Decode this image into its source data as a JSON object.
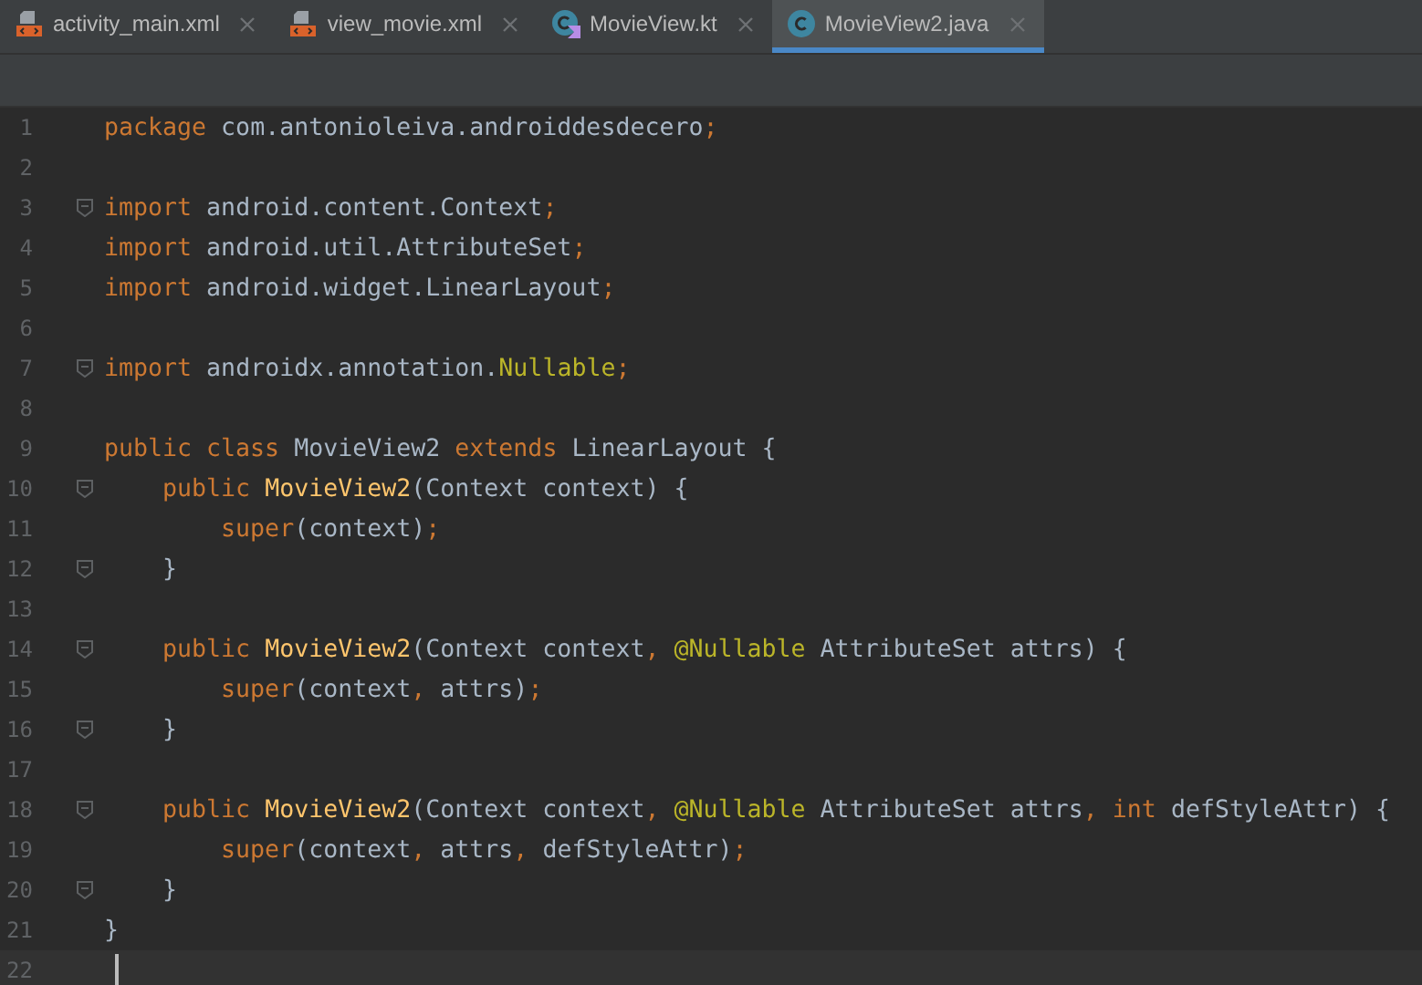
{
  "tabs": [
    {
      "label": "activity_main.xml",
      "kind": "xml",
      "selected": false
    },
    {
      "label": "view_movie.xml",
      "kind": "xml",
      "selected": false
    },
    {
      "label": "MovieView.kt",
      "kind": "kotlin",
      "selected": false
    },
    {
      "label": "MovieView2.java",
      "kind": "java",
      "selected": true
    }
  ],
  "editor": {
    "lines": [
      {
        "number": "1",
        "fold": false,
        "current": false,
        "tokens": [
          {
            "kind": "kw",
            "text": "package"
          },
          {
            "kind": "plain",
            "text": " com.antonioleiva.androiddesdecero"
          },
          {
            "kind": "punct",
            "text": ";"
          }
        ]
      },
      {
        "number": "2",
        "fold": false,
        "current": false
      },
      {
        "number": "3",
        "fold": true,
        "current": false,
        "tokens": [
          {
            "kind": "kw",
            "text": "import"
          },
          {
            "kind": "plain",
            "text": " android.content.Context"
          },
          {
            "kind": "punct",
            "text": ";"
          }
        ]
      },
      {
        "number": "4",
        "fold": false,
        "current": false,
        "tokens": [
          {
            "kind": "kw",
            "text": "import"
          },
          {
            "kind": "plain",
            "text": " android.util.AttributeSet"
          },
          {
            "kind": "punct",
            "text": ";"
          }
        ]
      },
      {
        "number": "5",
        "fold": false,
        "current": false,
        "tokens": [
          {
            "kind": "kw",
            "text": "import"
          },
          {
            "kind": "plain",
            "text": " android.widget.LinearLayout"
          },
          {
            "kind": "punct",
            "text": ";"
          }
        ]
      },
      {
        "number": "6",
        "fold": false,
        "current": false
      },
      {
        "number": "7",
        "fold": true,
        "current": false,
        "tokens": [
          {
            "kind": "kw",
            "text": "import"
          },
          {
            "kind": "plain",
            "text": " androidx.annotation."
          },
          {
            "kind": "annotation",
            "text": "Nullable"
          },
          {
            "kind": "punct",
            "text": ";"
          }
        ]
      },
      {
        "number": "8",
        "fold": false,
        "current": false
      },
      {
        "number": "9",
        "fold": false,
        "current": false,
        "tokens": [
          {
            "kind": "kw",
            "text": "public class"
          },
          {
            "kind": "plain",
            "text": " MovieView2 "
          },
          {
            "kind": "kw",
            "text": "extends"
          },
          {
            "kind": "plain",
            "text": " LinearLayout {"
          }
        ]
      },
      {
        "number": "10",
        "fold": true,
        "current": false,
        "tokens": [
          {
            "kind": "kw",
            "text": "    public "
          },
          {
            "kind": "method",
            "text": "MovieView2"
          },
          {
            "kind": "plain",
            "text": "(Context context) {"
          }
        ]
      },
      {
        "number": "11",
        "fold": false,
        "current": false,
        "tokens": [
          {
            "kind": "kw",
            "text": "        super"
          },
          {
            "kind": "plain",
            "text": "(context)"
          },
          {
            "kind": "punct",
            "text": ";"
          }
        ]
      },
      {
        "number": "12",
        "fold": true,
        "current": false,
        "tokens": [
          {
            "kind": "plain",
            "text": "    }"
          }
        ]
      },
      {
        "number": "13",
        "fold": false,
        "current": false
      },
      {
        "number": "14",
        "fold": true,
        "current": false,
        "tokens": [
          {
            "kind": "kw",
            "text": "    public "
          },
          {
            "kind": "method",
            "text": "MovieView2"
          },
          {
            "kind": "plain",
            "text": "(Context context"
          },
          {
            "kind": "punct",
            "text": ", "
          },
          {
            "kind": "annotation",
            "text": "@Nullable"
          },
          {
            "kind": "plain",
            "text": " AttributeSet attrs) {"
          }
        ]
      },
      {
        "number": "15",
        "fold": false,
        "current": false,
        "tokens": [
          {
            "kind": "kw",
            "text": "        super"
          },
          {
            "kind": "plain",
            "text": "(context"
          },
          {
            "kind": "punct",
            "text": ", "
          },
          {
            "kind": "plain",
            "text": "attrs)"
          },
          {
            "kind": "punct",
            "text": ";"
          }
        ]
      },
      {
        "number": "16",
        "fold": true,
        "current": false,
        "tokens": [
          {
            "kind": "plain",
            "text": "    }"
          }
        ]
      },
      {
        "number": "17",
        "fold": false,
        "current": false
      },
      {
        "number": "18",
        "fold": true,
        "current": false,
        "tokens": [
          {
            "kind": "kw",
            "text": "    public "
          },
          {
            "kind": "method",
            "text": "MovieView2"
          },
          {
            "kind": "plain",
            "text": "(Context context"
          },
          {
            "kind": "punct",
            "text": ", "
          },
          {
            "kind": "annotation",
            "text": "@Nullable"
          },
          {
            "kind": "plain",
            "text": " AttributeSet attrs"
          },
          {
            "kind": "punct",
            "text": ", "
          },
          {
            "kind": "kw",
            "text": "int"
          },
          {
            "kind": "plain",
            "text": " defStyleAttr) {"
          }
        ]
      },
      {
        "number": "19",
        "fold": false,
        "current": false,
        "tokens": [
          {
            "kind": "kw",
            "text": "        super"
          },
          {
            "kind": "plain",
            "text": "(context"
          },
          {
            "kind": "punct",
            "text": ", "
          },
          {
            "kind": "plain",
            "text": "attrs"
          },
          {
            "kind": "punct",
            "text": ", "
          },
          {
            "kind": "plain",
            "text": "defStyleAttr)"
          },
          {
            "kind": "punct",
            "text": ";"
          }
        ]
      },
      {
        "number": "20",
        "fold": true,
        "current": false,
        "tokens": [
          {
            "kind": "plain",
            "text": "    }"
          }
        ]
      },
      {
        "number": "21",
        "fold": false,
        "current": false,
        "tokens": [
          {
            "kind": "plain",
            "text": "}"
          }
        ]
      },
      {
        "number": "22",
        "fold": false,
        "current": true
      }
    ]
  }
}
